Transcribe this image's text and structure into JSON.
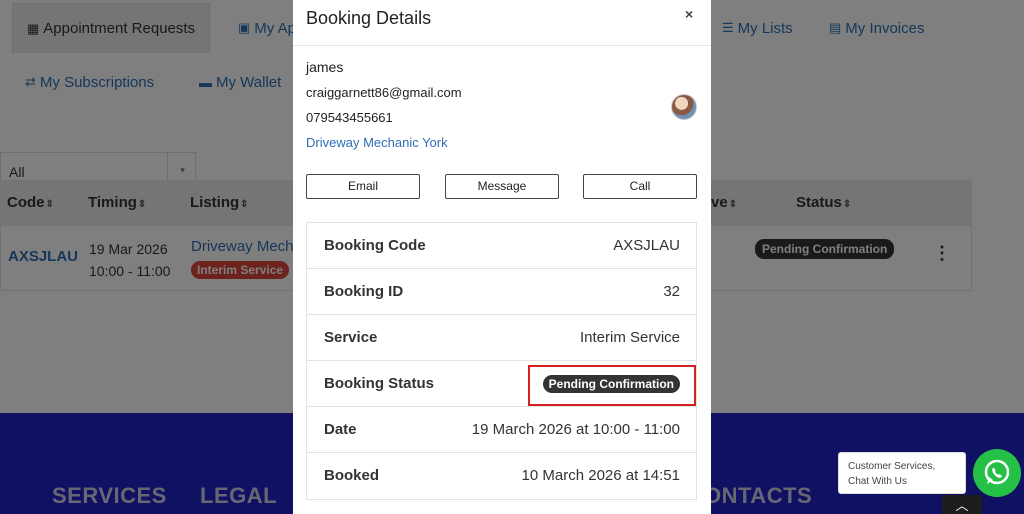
{
  "tabs": [
    {
      "label": "Appointment Requests",
      "icon": "calendar-icon"
    },
    {
      "label": "My Ap",
      "icon": "calendar-check-icon"
    },
    {
      "label": "My Lists",
      "icon": "list-icon"
    },
    {
      "label": "My Invoices",
      "icon": "invoice-icon"
    },
    {
      "label": "My Subscriptions",
      "icon": "refresh-icon"
    },
    {
      "label": "My Wallet",
      "icon": "wallet-icon"
    }
  ],
  "filter": {
    "value": "All"
  },
  "table": {
    "headers": {
      "code": "Code",
      "timing": "Timing",
      "listing": "Listing",
      "ve": "ve",
      "status": "Status"
    },
    "row": {
      "code": "AXSJLAU",
      "date": "19 Mar 2026",
      "time": "10:00 - 11:00",
      "listing": "Driveway Mech",
      "service_badge": "Interim Service",
      "status_badge": "Pending Confirmation"
    }
  },
  "footer": {
    "services": "SERVICES",
    "legal": "LEGAL",
    "contacts": "ONTACTS"
  },
  "modal": {
    "title": "Booking Details",
    "close": "×",
    "customer": {
      "name": "james",
      "email": "craiggarnett86@gmail.com",
      "phone": "079543455661",
      "listing_link": "Driveway Mechanic York"
    },
    "buttons": {
      "email": "Email",
      "message": "Message",
      "call": "Call"
    },
    "details": [
      {
        "label": "Booking Code",
        "value": "AXSJLAU"
      },
      {
        "label": "Booking ID",
        "value": "32"
      },
      {
        "label": "Service",
        "value": "Interim Service"
      },
      {
        "label": "Booking Status",
        "value": "Pending Confirmation"
      },
      {
        "label": "Date",
        "value": "19 March 2026 at 10:00 - 11:00"
      },
      {
        "label": "Booked",
        "value": "10 March 2026 at 14:51"
      }
    ]
  },
  "chat": {
    "text": "Customer Services, Chat With Us",
    "wa_color": "#25c146"
  },
  "colors": {
    "link": "#2f6fb5",
    "footer": "#2323c8",
    "badge_dark": "#343434",
    "badge_red": "#d9453b",
    "highlight": "#d32020"
  }
}
